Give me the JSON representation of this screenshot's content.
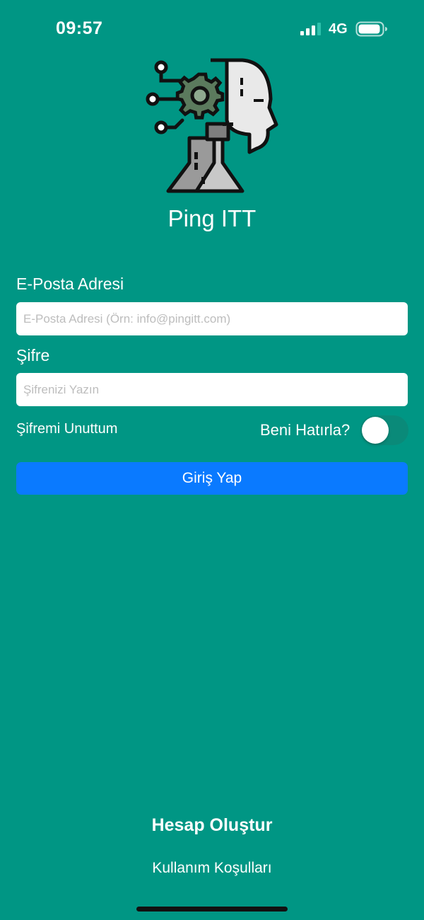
{
  "status_bar": {
    "time": "09:57",
    "network": "4G",
    "signal_icon": "cellular-signal-icon",
    "battery_icon": "battery-icon"
  },
  "app": {
    "title": "Ping ITT",
    "logo_icon": "ai-head-gear-circuit-logo"
  },
  "form": {
    "email_label": "E-Posta Adresi",
    "email_placeholder": "E-Posta Adresi (Örn: info@pingitt.com)",
    "email_value": "",
    "password_label": "Şifre",
    "password_placeholder": "Şifrenizi Yazın",
    "password_value": "",
    "forgot_password": "Şifremi Unuttum",
    "remember_me_label": "Beni Hatırla?",
    "remember_me_on": false,
    "login_button": "Giriş Yap"
  },
  "footer": {
    "create_account": "Hesap Oluştur",
    "terms": "Kullanım Koşulları"
  },
  "colors": {
    "background": "#009684",
    "primary_button": "#0a7aff",
    "toggle_off_track": "#0a8a79"
  }
}
